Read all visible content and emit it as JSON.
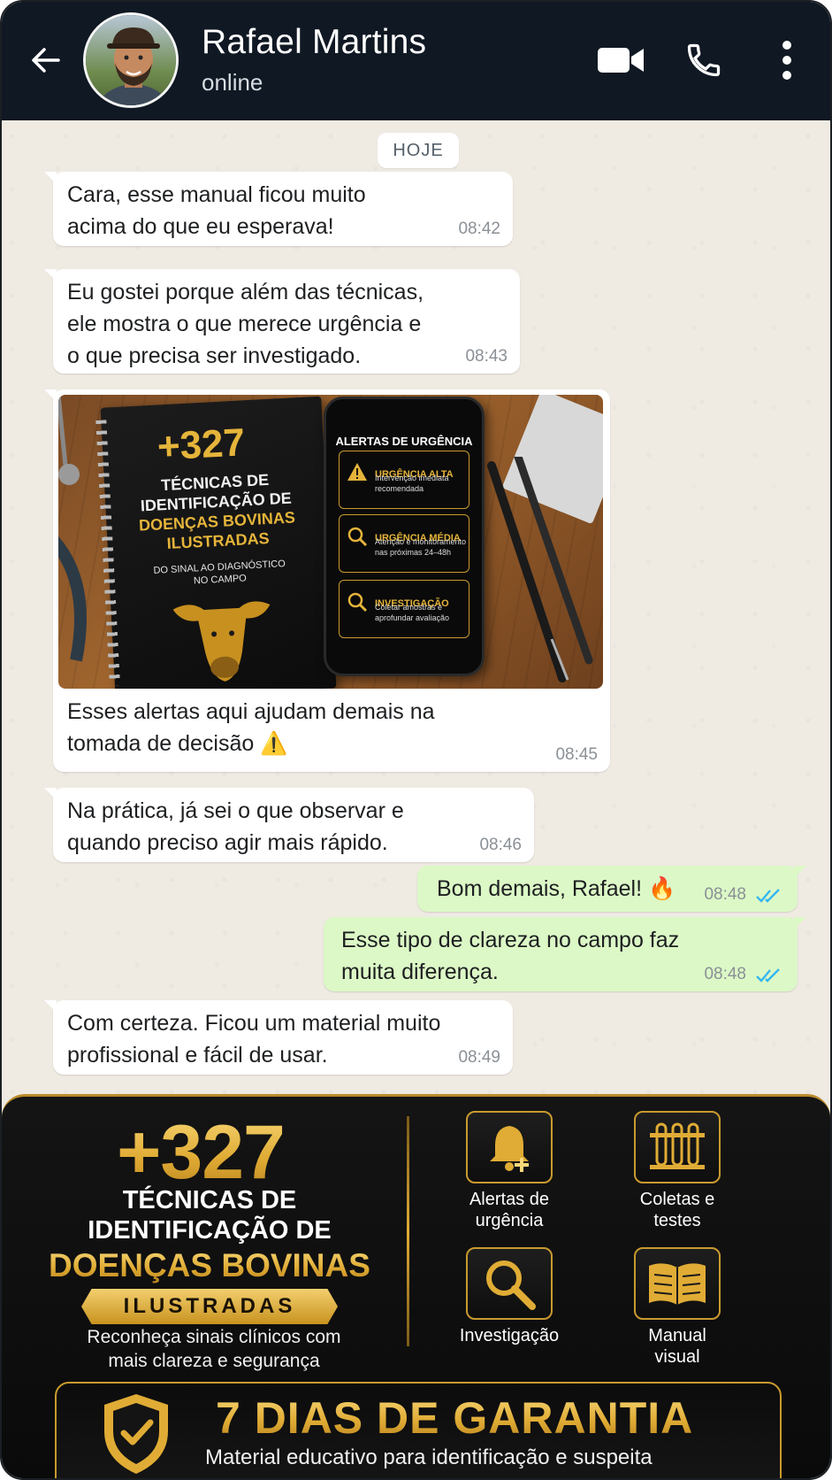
{
  "header": {
    "name": "Rafael Martins",
    "status": "online",
    "colors": {
      "background": "#0f1823",
      "text": "#ffffff"
    },
    "icons": [
      "back-arrow-icon",
      "video-camera-icon",
      "phone-icon",
      "more-vertical-icon"
    ]
  },
  "chat": {
    "date_label": "HOJE",
    "colors": {
      "incoming": "#ffffff",
      "outgoing": "#dcf8c6",
      "read_ticks": "#34b7f1"
    },
    "messages": [
      {
        "text": "Cara, esse manual ficou muito\nacima do que eu esperava!",
        "time": "08:42"
      },
      {
        "text": "Eu gostei porque além das técnicas,\nele mostra o que merece urgência e\no que precisa ser investigado.",
        "time": "08:43"
      },
      {
        "text": "Esses alertas aqui ajudam demais na\ntomada de decisão ⚠️",
        "time": "08:45"
      },
      {
        "text": "Na prática, já sei o que observar e\nquando preciso agir mais rápido.",
        "time": "08:46"
      },
      {
        "text": "Bom demais, Rafael! 🔥",
        "time": "08:48"
      },
      {
        "text": "Esse tipo de clareza no campo faz\nmuita diferença.",
        "time": "08:48"
      },
      {
        "text": "Com certeza. Ficou um material muito\nprofissional e fácil de usar.",
        "time": "08:49"
      }
    ],
    "image": {
      "book_number": "+327",
      "book_title_white": "TÉCNICAS DE\nIDENTIFICAÇÃO DE",
      "book_title_gold": "DOENÇAS BOVINAS\nILUSTRADAS",
      "book_subtitle": "DO SINAL AO DIAGNÓSTICO\nNO CAMPO",
      "phone_title": "ALERTAS DE URGÊNCIA",
      "alerts": [
        {
          "title": "URGÊNCIA ALTA",
          "desc": "Intervenção imediata recomendada"
        },
        {
          "title": "URGÊNCIA MÉDIA",
          "desc": "Atenção e monitoramento nas próximas 24–48h"
        },
        {
          "title": "INVESTIGAÇÃO",
          "desc": "Coletar amostras e aprofundar avaliação"
        }
      ]
    }
  },
  "promo": {
    "number": "+327",
    "line1": "TÉCNICAS DE",
    "line2": "IDENTIFICAÇÃO DE",
    "line3": "DOENÇAS BOVINAS",
    "ribbon": "ILUSTRADAS",
    "description": "Reconheça sinais clínicos com\nmais clareza e segurança",
    "features": [
      {
        "label": "Alertas de\nurgência",
        "icon": "bell-plus-icon"
      },
      {
        "label": "Coletas e\ntestes",
        "icon": "test-tubes-icon"
      },
      {
        "label": "Investigação",
        "icon": "magnifier-icon"
      },
      {
        "label": "Manual\nvisual",
        "icon": "open-book-icon"
      }
    ],
    "guarantee_title": "7 DIAS DE GARANTIA",
    "guarantee_subtitle": "Material educativo para identificação e suspeita",
    "colors": {
      "gold": "#e0ac35",
      "background": "#0f0f0f"
    }
  }
}
